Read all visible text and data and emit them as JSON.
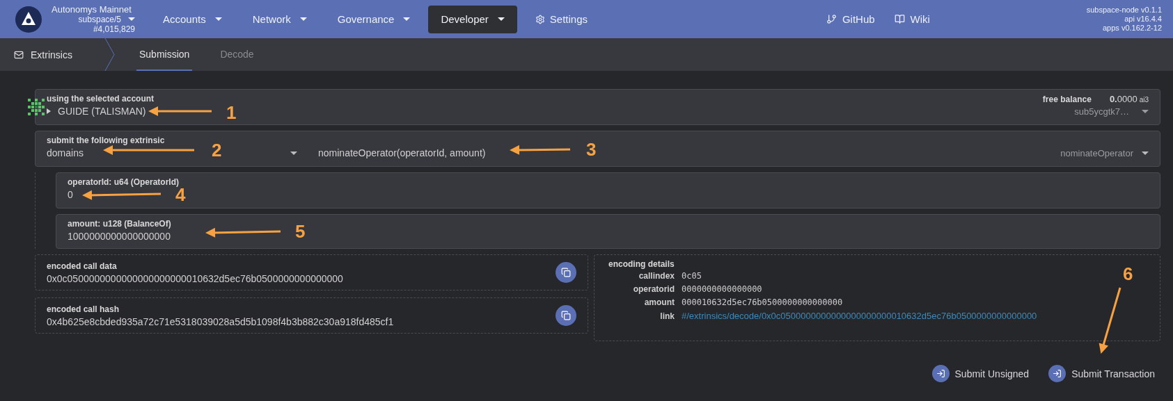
{
  "header": {
    "chain": {
      "name": "Autonomys Mainnet",
      "spec": "subspace/5",
      "block": "#4,015,829"
    },
    "nav": [
      {
        "label": "Accounts",
        "dropdown": true,
        "selected": false
      },
      {
        "label": "Network",
        "dropdown": true,
        "selected": false
      },
      {
        "label": "Governance",
        "dropdown": true,
        "selected": false
      },
      {
        "label": "Developer",
        "dropdown": true,
        "selected": true
      },
      {
        "label": "Settings",
        "dropdown": false,
        "selected": false
      }
    ],
    "links": [
      "GitHub",
      "Wiki"
    ],
    "versions": [
      "subspace-node v0.1.1",
      "api v16.4.4",
      "apps v0.162.2-12"
    ]
  },
  "subnav": {
    "section": "Extrinsics",
    "tabs": [
      {
        "label": "Submission",
        "selected": true
      },
      {
        "label": "Decode",
        "selected": false
      }
    ]
  },
  "account": {
    "label": "using the selected account",
    "name": "GUIDE (TALISMAN)",
    "balance_label": "free balance",
    "balance": "**0.**0000",
    "unit": "ai3",
    "address": "sub5ycgtk7…"
  },
  "extrinsic": {
    "label": "submit the following extrinsic",
    "section": "domains",
    "method": "nominateOperator(operatorId, amount)",
    "method_short": "nominateOperator"
  },
  "params": [
    {
      "label": "operatorId: u64 (OperatorId)",
      "value": "0"
    },
    {
      "label": "amount: u128 (BalanceOf)",
      "value": "1000000000000000000"
    }
  ],
  "encoded": [
    {
      "label": "encoded call data",
      "value": "0x0c0500000000000000000000010632d5ec76b0500000000000000"
    },
    {
      "label": "encoded call hash",
      "value": "0x4b625e8cbded935a72c71e5318039028a5d5b1098f4b3b882c30a918fd485cf1"
    }
  ],
  "encoding_details": {
    "title": "encoding details",
    "rows": [
      {
        "key": "callindex",
        "value": "0c05",
        "kind": "text"
      },
      {
        "key": "operatorid",
        "value": "0000000000000000",
        "kind": "text"
      },
      {
        "key": "amount",
        "value": "000010632d5ec76b0500000000000000",
        "kind": "text"
      },
      {
        "key": "link",
        "value": "#/extrinsics/decode/0x0c0500000000000000000000010632d5ec76b0500000000000000",
        "kind": "link"
      }
    ]
  },
  "actions": [
    "Submit Unsigned",
    "Submit Transaction"
  ],
  "annotations": [
    "1",
    "2",
    "3",
    "4",
    "5",
    "6"
  ]
}
